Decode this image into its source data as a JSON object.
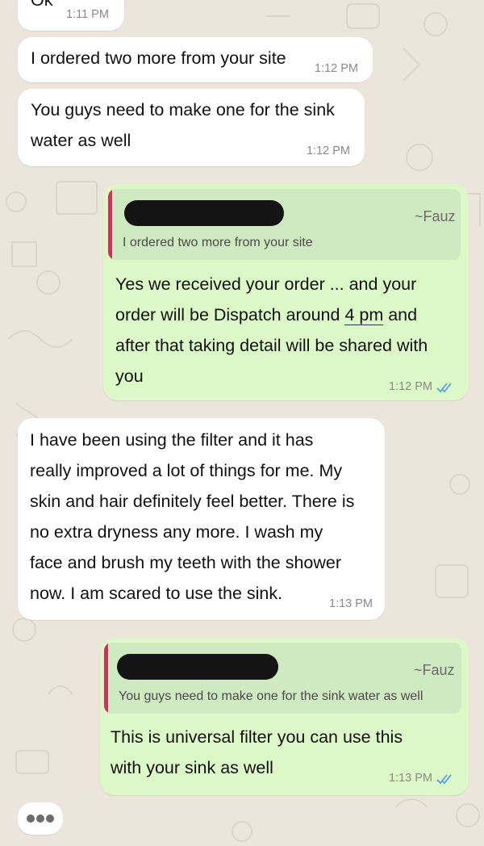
{
  "messages": [
    {
      "direction": "incoming",
      "text": "Ok",
      "time": "1:11 PM"
    },
    {
      "direction": "incoming",
      "text": "I ordered two more from your site",
      "time": "1:12 PM"
    },
    {
      "direction": "incoming",
      "line1": "You guys need to make one for the sink",
      "line2": "water as well",
      "time": "1:12 PM"
    },
    {
      "direction": "outgoing",
      "quoted_sender": "~Fauz",
      "quoted_text": "I ordered two more from your site",
      "line1": "Yes we received your order ... and your",
      "line2_pre": "order will be Dispatch around ",
      "line2_link": "4 pm",
      "line2_post": " and",
      "line3": "after that taking detail will be shared with",
      "line4": "you",
      "time": "1:12 PM",
      "status": "read"
    },
    {
      "direction": "incoming",
      "line1": "I have been using the filter and it has",
      "line2": "really improved a lot of things for me. My",
      "line3": "skin and hair definitely feel better. There is",
      "line4": "no extra dryness any more. I wash my",
      "line5": "face and brush my teeth with the shower",
      "line6": "now. I am scared to use the sink.",
      "time": "1:13 PM"
    },
    {
      "direction": "outgoing",
      "quoted_sender": "~Fauz",
      "quoted_text": "You guys need to make one for the sink water as well",
      "line1": "This is universal filter you can use this",
      "line2": "with your sink as well",
      "time": "1:13 PM",
      "status": "read"
    }
  ],
  "colors": {
    "incoming": "#ffffff",
    "outgoing": "#dcf8c6",
    "quote_bar": "#d62e5c",
    "read_ticks": "#4fa3e0",
    "background": "#ece5dc"
  }
}
